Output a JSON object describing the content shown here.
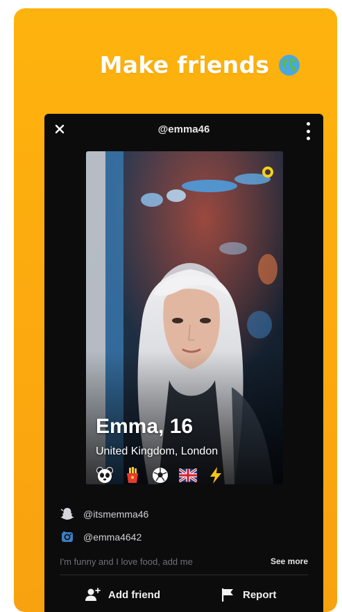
{
  "promo": {
    "headline": "Make friends"
  },
  "profile_header": {
    "username": "@emma46"
  },
  "profile": {
    "name_age": "Emma, 16",
    "location": "United Kingdom, London",
    "interest_badges": [
      "panda-icon",
      "fries-icon",
      "soccer-ball-icon",
      "uk-flag-icon",
      "lightning-icon"
    ]
  },
  "socials": [
    {
      "icon": "snapchat-ghost-icon",
      "handle": "@itsmemma46"
    },
    {
      "icon": "instagram-icon",
      "handle": "@emma4642"
    }
  ],
  "bio": {
    "text": "I'm funny and I love food, add me",
    "see_more": "See more"
  },
  "actions": {
    "add_friend": "Add friend",
    "report": "Report"
  },
  "colors": {
    "brand": "#fdb30d",
    "background_dark": "#0c0c0d",
    "accent_ring": "#f6d21a"
  }
}
